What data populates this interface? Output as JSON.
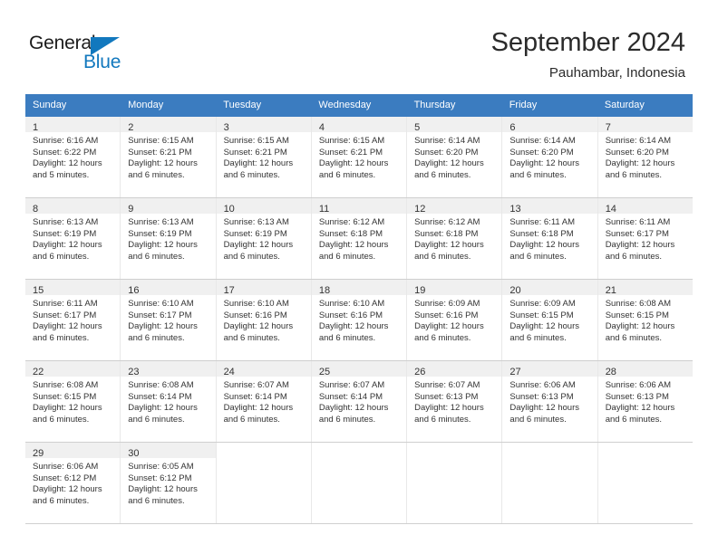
{
  "brand": {
    "name_top": "General",
    "name_bottom": "Blue",
    "accent_color": "#1278be"
  },
  "header": {
    "month_title": "September 2024",
    "location": "Pauhambar, Indonesia"
  },
  "theme": {
    "header_row_bg": "#3b7cc0",
    "daynum_band_bg": "#f0f0f0",
    "text_color": "#333333"
  },
  "weekdays": [
    "Sunday",
    "Monday",
    "Tuesday",
    "Wednesday",
    "Thursday",
    "Friday",
    "Saturday"
  ],
  "labels": {
    "sunrise_prefix": "Sunrise:",
    "sunset_prefix": "Sunset:",
    "daylight_prefix": "Daylight:"
  },
  "weeks": [
    [
      {
        "day": "1",
        "sunrise": "Sunrise: 6:16 AM",
        "sunset": "Sunset: 6:22 PM",
        "daylight1": "Daylight: 12 hours",
        "daylight2": "and 5 minutes."
      },
      {
        "day": "2",
        "sunrise": "Sunrise: 6:15 AM",
        "sunset": "Sunset: 6:21 PM",
        "daylight1": "Daylight: 12 hours",
        "daylight2": "and 6 minutes."
      },
      {
        "day": "3",
        "sunrise": "Sunrise: 6:15 AM",
        "sunset": "Sunset: 6:21 PM",
        "daylight1": "Daylight: 12 hours",
        "daylight2": "and 6 minutes."
      },
      {
        "day": "4",
        "sunrise": "Sunrise: 6:15 AM",
        "sunset": "Sunset: 6:21 PM",
        "daylight1": "Daylight: 12 hours",
        "daylight2": "and 6 minutes."
      },
      {
        "day": "5",
        "sunrise": "Sunrise: 6:14 AM",
        "sunset": "Sunset: 6:20 PM",
        "daylight1": "Daylight: 12 hours",
        "daylight2": "and 6 minutes."
      },
      {
        "day": "6",
        "sunrise": "Sunrise: 6:14 AM",
        "sunset": "Sunset: 6:20 PM",
        "daylight1": "Daylight: 12 hours",
        "daylight2": "and 6 minutes."
      },
      {
        "day": "7",
        "sunrise": "Sunrise: 6:14 AM",
        "sunset": "Sunset: 6:20 PM",
        "daylight1": "Daylight: 12 hours",
        "daylight2": "and 6 minutes."
      }
    ],
    [
      {
        "day": "8",
        "sunrise": "Sunrise: 6:13 AM",
        "sunset": "Sunset: 6:19 PM",
        "daylight1": "Daylight: 12 hours",
        "daylight2": "and 6 minutes."
      },
      {
        "day": "9",
        "sunrise": "Sunrise: 6:13 AM",
        "sunset": "Sunset: 6:19 PM",
        "daylight1": "Daylight: 12 hours",
        "daylight2": "and 6 minutes."
      },
      {
        "day": "10",
        "sunrise": "Sunrise: 6:13 AM",
        "sunset": "Sunset: 6:19 PM",
        "daylight1": "Daylight: 12 hours",
        "daylight2": "and 6 minutes."
      },
      {
        "day": "11",
        "sunrise": "Sunrise: 6:12 AM",
        "sunset": "Sunset: 6:18 PM",
        "daylight1": "Daylight: 12 hours",
        "daylight2": "and 6 minutes."
      },
      {
        "day": "12",
        "sunrise": "Sunrise: 6:12 AM",
        "sunset": "Sunset: 6:18 PM",
        "daylight1": "Daylight: 12 hours",
        "daylight2": "and 6 minutes."
      },
      {
        "day": "13",
        "sunrise": "Sunrise: 6:11 AM",
        "sunset": "Sunset: 6:18 PM",
        "daylight1": "Daylight: 12 hours",
        "daylight2": "and 6 minutes."
      },
      {
        "day": "14",
        "sunrise": "Sunrise: 6:11 AM",
        "sunset": "Sunset: 6:17 PM",
        "daylight1": "Daylight: 12 hours",
        "daylight2": "and 6 minutes."
      }
    ],
    [
      {
        "day": "15",
        "sunrise": "Sunrise: 6:11 AM",
        "sunset": "Sunset: 6:17 PM",
        "daylight1": "Daylight: 12 hours",
        "daylight2": "and 6 minutes."
      },
      {
        "day": "16",
        "sunrise": "Sunrise: 6:10 AM",
        "sunset": "Sunset: 6:17 PM",
        "daylight1": "Daylight: 12 hours",
        "daylight2": "and 6 minutes."
      },
      {
        "day": "17",
        "sunrise": "Sunrise: 6:10 AM",
        "sunset": "Sunset: 6:16 PM",
        "daylight1": "Daylight: 12 hours",
        "daylight2": "and 6 minutes."
      },
      {
        "day": "18",
        "sunrise": "Sunrise: 6:10 AM",
        "sunset": "Sunset: 6:16 PM",
        "daylight1": "Daylight: 12 hours",
        "daylight2": "and 6 minutes."
      },
      {
        "day": "19",
        "sunrise": "Sunrise: 6:09 AM",
        "sunset": "Sunset: 6:16 PM",
        "daylight1": "Daylight: 12 hours",
        "daylight2": "and 6 minutes."
      },
      {
        "day": "20",
        "sunrise": "Sunrise: 6:09 AM",
        "sunset": "Sunset: 6:15 PM",
        "daylight1": "Daylight: 12 hours",
        "daylight2": "and 6 minutes."
      },
      {
        "day": "21",
        "sunrise": "Sunrise: 6:08 AM",
        "sunset": "Sunset: 6:15 PM",
        "daylight1": "Daylight: 12 hours",
        "daylight2": "and 6 minutes."
      }
    ],
    [
      {
        "day": "22",
        "sunrise": "Sunrise: 6:08 AM",
        "sunset": "Sunset: 6:15 PM",
        "daylight1": "Daylight: 12 hours",
        "daylight2": "and 6 minutes."
      },
      {
        "day": "23",
        "sunrise": "Sunrise: 6:08 AM",
        "sunset": "Sunset: 6:14 PM",
        "daylight1": "Daylight: 12 hours",
        "daylight2": "and 6 minutes."
      },
      {
        "day": "24",
        "sunrise": "Sunrise: 6:07 AM",
        "sunset": "Sunset: 6:14 PM",
        "daylight1": "Daylight: 12 hours",
        "daylight2": "and 6 minutes."
      },
      {
        "day": "25",
        "sunrise": "Sunrise: 6:07 AM",
        "sunset": "Sunset: 6:14 PM",
        "daylight1": "Daylight: 12 hours",
        "daylight2": "and 6 minutes."
      },
      {
        "day": "26",
        "sunrise": "Sunrise: 6:07 AM",
        "sunset": "Sunset: 6:13 PM",
        "daylight1": "Daylight: 12 hours",
        "daylight2": "and 6 minutes."
      },
      {
        "day": "27",
        "sunrise": "Sunrise: 6:06 AM",
        "sunset": "Sunset: 6:13 PM",
        "daylight1": "Daylight: 12 hours",
        "daylight2": "and 6 minutes."
      },
      {
        "day": "28",
        "sunrise": "Sunrise: 6:06 AM",
        "sunset": "Sunset: 6:13 PM",
        "daylight1": "Daylight: 12 hours",
        "daylight2": "and 6 minutes."
      }
    ],
    [
      {
        "day": "29",
        "sunrise": "Sunrise: 6:06 AM",
        "sunset": "Sunset: 6:12 PM",
        "daylight1": "Daylight: 12 hours",
        "daylight2": "and 6 minutes."
      },
      {
        "day": "30",
        "sunrise": "Sunrise: 6:05 AM",
        "sunset": "Sunset: 6:12 PM",
        "daylight1": "Daylight: 12 hours",
        "daylight2": "and 6 minutes."
      },
      {
        "day": "",
        "sunrise": "",
        "sunset": "",
        "daylight1": "",
        "daylight2": ""
      },
      {
        "day": "",
        "sunrise": "",
        "sunset": "",
        "daylight1": "",
        "daylight2": ""
      },
      {
        "day": "",
        "sunrise": "",
        "sunset": "",
        "daylight1": "",
        "daylight2": ""
      },
      {
        "day": "",
        "sunrise": "",
        "sunset": "",
        "daylight1": "",
        "daylight2": ""
      },
      {
        "day": "",
        "sunrise": "",
        "sunset": "",
        "daylight1": "",
        "daylight2": ""
      }
    ]
  ]
}
